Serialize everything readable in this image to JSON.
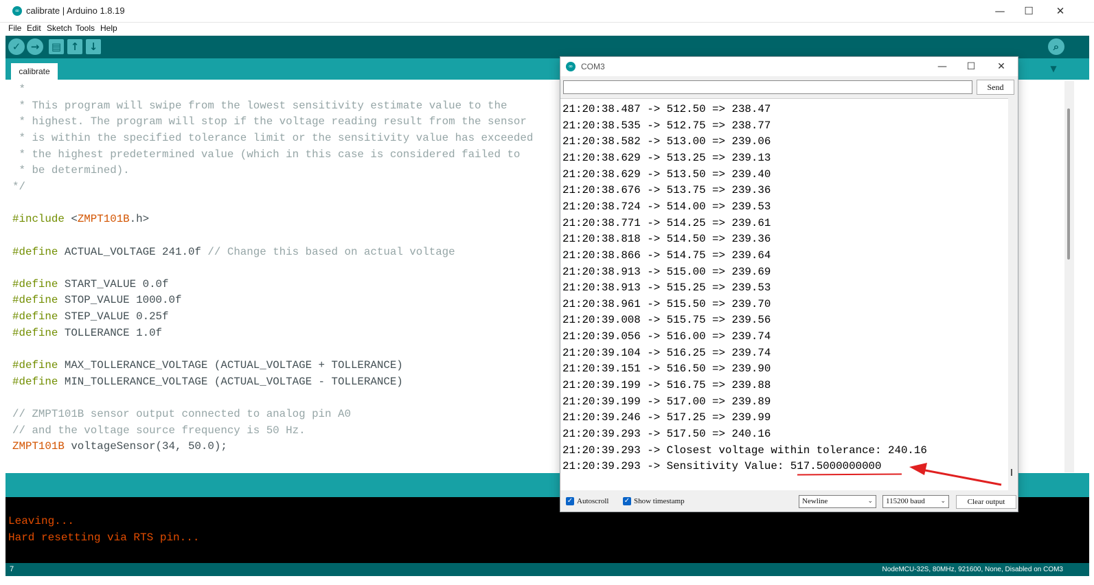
{
  "window": {
    "title": "calibrate | Arduino 1.8.19",
    "logo_glyph": "∞",
    "minimize": "—",
    "maximize": "☐",
    "close": "✕"
  },
  "menu": [
    "File",
    "Edit",
    "Sketch",
    "Tools",
    "Help"
  ],
  "toolbar": {
    "verify": "✓",
    "upload": "→",
    "new": "▤",
    "open": "↑",
    "save": "↓",
    "serial_monitor": "⌕"
  },
  "tab": {
    "label": "calibrate",
    "menu_glyph": "▼"
  },
  "code_lines": [
    [
      {
        "t": " *",
        "c": "com"
      }
    ],
    [
      {
        "t": " * This program will swipe from the lowest sensitivity estimate value to the",
        "c": "com"
      }
    ],
    [
      {
        "t": " * highest. The program will stop if the voltage reading result from the sensor",
        "c": "com"
      }
    ],
    [
      {
        "t": " * is within the specified tolerance limit or the sensitivity value has exceeded",
        "c": "com"
      }
    ],
    [
      {
        "t": " * the highest predetermined value (which in this case is considered failed to",
        "c": "com"
      }
    ],
    [
      {
        "t": " * be determined).",
        "c": "com"
      }
    ],
    [
      {
        "t": "*/",
        "c": "com"
      }
    ],
    [],
    [
      {
        "t": "#include",
        "c": "kw"
      },
      {
        "t": " <"
      },
      {
        "t": "ZMPT101B",
        "c": "ty"
      },
      {
        "t": ".h>"
      }
    ],
    [],
    [
      {
        "t": "#define",
        "c": "kw"
      },
      {
        "t": " ACTUAL_VOLTAGE 241.0f "
      },
      {
        "t": "// Change this based on actual voltage",
        "c": "com"
      }
    ],
    [],
    [
      {
        "t": "#define",
        "c": "kw"
      },
      {
        "t": " START_VALUE 0.0f"
      }
    ],
    [
      {
        "t": "#define",
        "c": "kw"
      },
      {
        "t": " STOP_VALUE 1000.0f"
      }
    ],
    [
      {
        "t": "#define",
        "c": "kw"
      },
      {
        "t": " STEP_VALUE 0.25f"
      }
    ],
    [
      {
        "t": "#define",
        "c": "kw"
      },
      {
        "t": " TOLLERANCE 1.0f"
      }
    ],
    [],
    [
      {
        "t": "#define",
        "c": "kw"
      },
      {
        "t": " MAX_TOLLERANCE_VOLTAGE (ACTUAL_VOLTAGE + TOLLERANCE)"
      }
    ],
    [
      {
        "t": "#define",
        "c": "kw"
      },
      {
        "t": " MIN_TOLLERANCE_VOLTAGE (ACTUAL_VOLTAGE - TOLLERANCE)"
      }
    ],
    [],
    [
      {
        "t": "// ZMPT101B sensor output connected to analog pin A0",
        "c": "com"
      }
    ],
    [
      {
        "t": "// and the voltage source frequency is 50 Hz.",
        "c": "com"
      }
    ],
    [
      {
        "t": "ZMPT101B",
        "c": "ty"
      },
      {
        "t": " voltageSensor(34, 50.0);"
      }
    ]
  ],
  "console": {
    "lines": [
      "Leaving...",
      "Hard resetting via RTS pin..."
    ]
  },
  "bottom": {
    "line_number": "7",
    "board": "NodeMCU-32S, 80MHz, 921600, None, Disabled on COM3"
  },
  "serial": {
    "title": "COM3",
    "input_value": "",
    "send_label": "Send",
    "lines": [
      "21:20:38.487 -> 512.50 => 238.47",
      "21:20:38.535 -> 512.75 => 238.77",
      "21:20:38.582 -> 513.00 => 239.06",
      "21:20:38.629 -> 513.25 => 239.13",
      "21:20:38.629 -> 513.50 => 239.40",
      "21:20:38.676 -> 513.75 => 239.36",
      "21:20:38.724 -> 514.00 => 239.53",
      "21:20:38.771 -> 514.25 => 239.61",
      "21:20:38.818 -> 514.50 => 239.36",
      "21:20:38.866 -> 514.75 => 239.64",
      "21:20:38.913 -> 515.00 => 239.69",
      "21:20:38.913 -> 515.25 => 239.53",
      "21:20:38.961 -> 515.50 => 239.70",
      "21:20:39.008 -> 515.75 => 239.56",
      "21:20:39.056 -> 516.00 => 239.74",
      "21:20:39.104 -> 516.25 => 239.74",
      "21:20:39.151 -> 516.50 => 239.90",
      "21:20:39.199 -> 516.75 => 239.88",
      "21:20:39.199 -> 517.00 => 239.89",
      "21:20:39.246 -> 517.25 => 239.99",
      "21:20:39.293 -> 517.50 => 240.16",
      "21:20:39.293 -> Closest voltage within tolerance: 240.16",
      "21:20:39.293 -> Sensitivity Value: 517.5000000000"
    ],
    "autoscroll_label": "Autoscroll",
    "timestamp_label": "Show timestamp",
    "check_glyph": "✓",
    "line_ending": "Newline",
    "baud": "115200 baud",
    "select_arrow": "⌄",
    "clear_label": "Clear output",
    "annotation_color": "#e02020"
  }
}
